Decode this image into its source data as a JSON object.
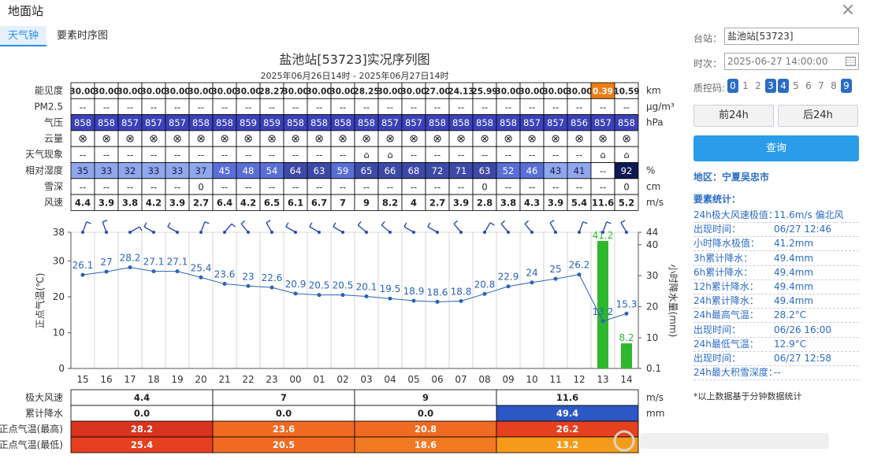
{
  "dialog": {
    "title": "地面站",
    "close_icon": "close-icon"
  },
  "tabs": [
    {
      "label": "天气钟"
    },
    {
      "label": "要素时序图"
    }
  ],
  "side": {
    "station_label": "台站：",
    "station_value": "盐池站[53723]",
    "time_label": "时次：",
    "time_value": "2025-06-27 14:00:00",
    "calendar_icon": "calendar-icon",
    "qc_label": "质控码:",
    "qc_codes": [
      {
        "code": "0",
        "on": true
      },
      {
        "code": "1",
        "on": false
      },
      {
        "code": "2",
        "on": false
      },
      {
        "code": "3",
        "on": true
      },
      {
        "code": "4",
        "on": true
      },
      {
        "code": "5",
        "on": false
      },
      {
        "code": "6",
        "on": false
      },
      {
        "code": "7",
        "on": false
      },
      {
        "code": "8",
        "on": false
      },
      {
        "code": "9",
        "on": true
      }
    ],
    "prev_label": "前24h",
    "next_label": "后24h",
    "query_label": "查询",
    "region": "地区：宁夏吴忠市",
    "stats_title": "要素统计：",
    "stats": [
      {
        "k": "24h极大风速极值：",
        "v": "11.6m/s 偏北风"
      },
      {
        "k": "出现时间：",
        "v": "06/27 12:46"
      },
      {
        "k": "小时降水极值：",
        "v": "41.2mm"
      },
      {
        "k": "3h累计降水：",
        "v": "49.4mm"
      },
      {
        "k": "6h累计降水：",
        "v": "49.4mm"
      },
      {
        "k": "12h累计降水：",
        "v": "49.4mm"
      },
      {
        "k": "24h累计降水：",
        "v": "49.4mm"
      },
      {
        "k": "24h最高气温：",
        "v": "28.2°C"
      },
      {
        "k": "出现时间：",
        "v": "06/26 16:00"
      },
      {
        "k": "24h最低气温：",
        "v": "12.9°C"
      },
      {
        "k": "出现时间：",
        "v": "06/27 12:58"
      },
      {
        "k": "24h最大积雪深度：",
        "v": "--"
      }
    ],
    "footnote": "*以上数据基于分钟数据统计"
  },
  "chart_data": {
    "type": "line",
    "title": "盐池站[53723]实况序列图",
    "subtitle": "2025年06月26日14时 - 2025年06月27日14时",
    "x": [
      "15",
      "16",
      "17",
      "18",
      "19",
      "20",
      "21",
      "22",
      "23",
      "00",
      "01",
      "02",
      "03",
      "04",
      "05",
      "06",
      "07",
      "08",
      "09",
      "10",
      "11",
      "12",
      "13",
      "14"
    ],
    "temperature": {
      "ylabel": "正点气温(℃)",
      "ylim": [
        0,
        38
      ],
      "ticks": [
        0,
        10,
        20,
        30,
        38
      ],
      "values": [
        26.1,
        27,
        28.2,
        27.1,
        27.1,
        25.4,
        23.6,
        23,
        22.6,
        20.9,
        20.5,
        20.5,
        20.1,
        19.5,
        18.9,
        18.6,
        18.8,
        20.8,
        22.9,
        24,
        25,
        26.2,
        13.2,
        15.3
      ],
      "color": "#2a62b8"
    },
    "precipitation": {
      "ylabel": "小时降水量(mm)",
      "tick_labels": [
        "0.1",
        "10",
        "20",
        "30",
        "40",
        "44"
      ],
      "ticks": [
        0.1,
        10,
        20,
        30,
        40,
        44
      ],
      "ylim": [
        0.1,
        44
      ],
      "values": [
        null,
        null,
        null,
        null,
        null,
        null,
        null,
        null,
        null,
        null,
        null,
        null,
        null,
        null,
        null,
        null,
        null,
        null,
        null,
        null,
        null,
        null,
        41.2,
        8.2
      ],
      "labels": [
        "",
        "",
        "",
        "",
        "",
        "",
        "",
        "",
        "",
        "",
        "",
        "",
        "",
        "",
        "",
        "",
        "",
        "",
        "",
        "",
        "",
        "",
        "41.2",
        "8.2"
      ],
      "color": "#2eb82e"
    },
    "wind_dirs_deg": [
      20,
      340,
      60,
      300,
      300,
      20,
      40,
      320,
      330,
      300,
      300,
      300,
      310,
      310,
      300,
      300,
      320,
      30,
      320,
      320,
      330,
      20,
      20,
      330
    ],
    "table": {
      "rows": [
        {
          "name": "能见度",
          "unit": "km",
          "values": [
            "30.00",
            "30.00",
            "30.00",
            "30.00",
            "30.00",
            "30.00",
            "30.00",
            "30.00",
            "28.27",
            "30.00",
            "30.00",
            "30.00",
            "28.25",
            "30.00",
            "30.00",
            "27.00",
            "24.13",
            "25.99",
            "30.00",
            "30.00",
            "30.00",
            "30.00",
            "0.39",
            "10.59"
          ]
        },
        {
          "name": "PM2.5",
          "unit": "μg/m³",
          "values": [
            "--",
            "--",
            "--",
            "--",
            "--",
            "--",
            "--",
            "--",
            "--",
            "--",
            "--",
            "--",
            "--",
            "--",
            "--",
            "--",
            "--",
            "--",
            "--",
            "--",
            "--",
            "--",
            "--",
            "--"
          ]
        },
        {
          "name": "气压",
          "unit": "hPa",
          "values": [
            "858",
            "858",
            "857",
            "857",
            "857",
            "858",
            "858",
            "859",
            "859",
            "858",
            "858",
            "858",
            "858",
            "857",
            "857",
            "858",
            "858",
            "858",
            "858",
            "857",
            "857",
            "856",
            "857",
            "858"
          ]
        },
        {
          "name": "云量",
          "unit": "",
          "values": [
            "⊗",
            "⊗",
            "⊗",
            "⊗",
            "⊗",
            "⊗",
            "⊗",
            "⊗",
            "⊗",
            "⊗",
            "⊗",
            "⊗",
            "⊗",
            "⊗",
            "⊗",
            "⊗",
            "⊗",
            "⊗",
            "⊗",
            "⊗",
            "⊗",
            "⊗",
            "⊗",
            "⊗"
          ]
        },
        {
          "name": "天气现象",
          "unit": "",
          "values": [
            "--",
            "--",
            "--",
            "--",
            "--",
            "--",
            "--",
            "--",
            "--",
            "--",
            "--",
            "--",
            "⌂",
            "⌂",
            "--",
            "--",
            "--",
            "--",
            "--",
            "--",
            "--",
            "--",
            "⌂",
            "⌂"
          ]
        },
        {
          "name": "相对湿度",
          "unit": "%",
          "values": [
            "35",
            "33",
            "32",
            "33",
            "33",
            "37",
            "45",
            "48",
            "54",
            "64",
            "63",
            "59",
            "65",
            "66",
            "68",
            "72",
            "71",
            "63",
            "52",
            "46",
            "43",
            "41",
            "--",
            "92"
          ]
        },
        {
          "name": "雪深",
          "unit": "cm",
          "values": [
            "--",
            "--",
            "--",
            "--",
            "--",
            "0",
            "--",
            "--",
            "--",
            "--",
            "--",
            "--",
            "--",
            "--",
            "--",
            "--",
            "--",
            "0",
            "--",
            "--",
            "--",
            "--",
            "--",
            "0"
          ]
        },
        {
          "name": "风速",
          "unit": "m/s",
          "values": [
            "4.4",
            "3.9",
            "3.8",
            "4.2",
            "3.9",
            "2.7",
            "6.4",
            "4.2",
            "6.5",
            "6.1",
            "6.7",
            "7",
            "9",
            "8.2",
            "4",
            "2.7",
            "3.9",
            "2.8",
            "3.8",
            "4.3",
            "3.9",
            "5.4",
            "11.6",
            "5.2"
          ]
        }
      ],
      "bottom_rows": [
        {
          "name": "极大风速",
          "unit": "m/s",
          "values": [
            "4.4",
            "7",
            "9",
            "11.6"
          ]
        },
        {
          "name": "累计降水",
          "unit": "mm",
          "values": [
            "0.0",
            "0.0",
            "0.0",
            "49.4"
          ]
        },
        {
          "name": "正点气温(最高)",
          "unit": "",
          "values": [
            "28.2",
            "23.6",
            "20.8",
            "26.2"
          ]
        },
        {
          "name": "正点气温(最低)",
          "unit": "",
          "values": [
            "25.4",
            "20.5",
            "18.6",
            "13.2"
          ]
        }
      ]
    }
  }
}
